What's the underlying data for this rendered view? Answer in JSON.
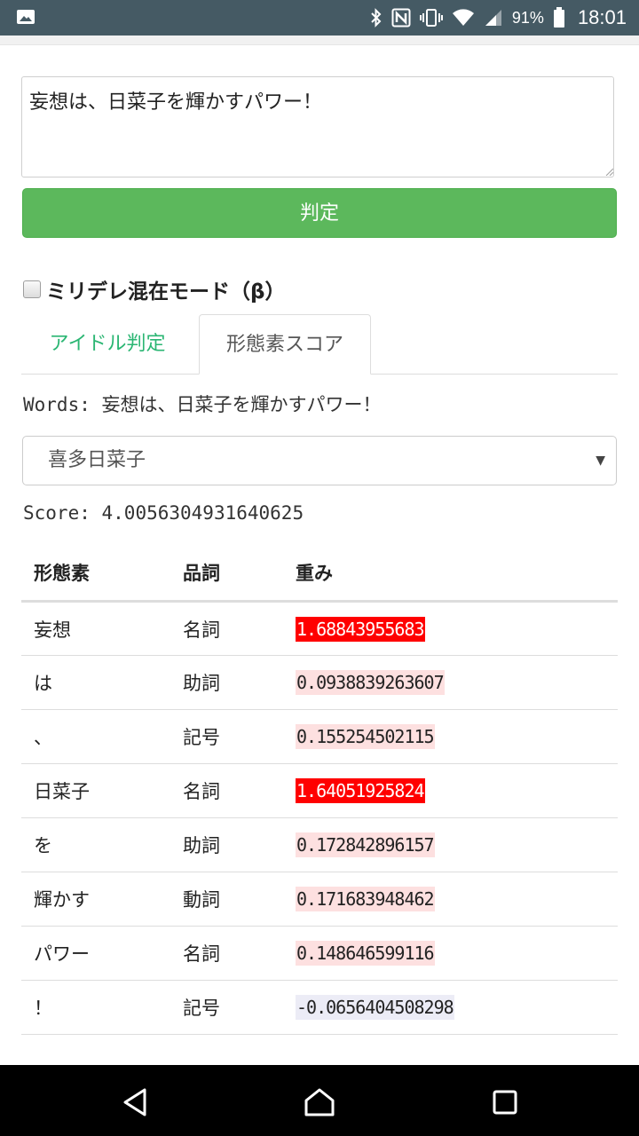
{
  "status_bar": {
    "battery_percent": "91%",
    "time": "18:01"
  },
  "input": {
    "value": "妄想は、日菜子を輝かすパワー！"
  },
  "judge_button": {
    "label": "判定"
  },
  "mode": {
    "label": "ミリデレ混在モード（β）",
    "checked": false
  },
  "tabs": [
    {
      "label": "アイドル判定",
      "active": false
    },
    {
      "label": "形態素スコア",
      "active": true
    }
  ],
  "words": {
    "prefix": "Words: ",
    "text": "妄想は、日菜子を輝かすパワー！"
  },
  "idol_select": {
    "selected": "喜多日菜子"
  },
  "score": {
    "prefix": "Score: ",
    "value": "4.0056304931640625"
  },
  "table": {
    "headers": [
      "形態素",
      "品詞",
      "重み"
    ],
    "rows": [
      {
        "morpheme": "妄想",
        "pos": "名詞",
        "weight": "1.68843955683",
        "level": "high"
      },
      {
        "morpheme": "は",
        "pos": "助詞",
        "weight": "0.0938839263607",
        "level": "low"
      },
      {
        "morpheme": "、",
        "pos": "記号",
        "weight": "0.155254502115",
        "level": "low"
      },
      {
        "morpheme": "日菜子",
        "pos": "名詞",
        "weight": "1.64051925824",
        "level": "high"
      },
      {
        "morpheme": "を",
        "pos": "助詞",
        "weight": "0.172842896157",
        "level": "low"
      },
      {
        "morpheme": "輝かす",
        "pos": "動詞",
        "weight": "0.171683948462",
        "level": "low"
      },
      {
        "morpheme": "パワー",
        "pos": "名詞",
        "weight": "0.148646599116",
        "level": "low"
      },
      {
        "morpheme": "！",
        "pos": "記号",
        "weight": "-0.0656404508298",
        "level": "negative"
      }
    ]
  },
  "colors": {
    "high_bg": "#ff0000",
    "high_fg": "#ffffff",
    "low_bg": "#fde0e0",
    "negative_bg": "#ececf6",
    "accent_green": "#5cb85c",
    "tab_green": "#2bb673"
  },
  "icons": {
    "status_left": "image-notification-icon",
    "status_right": [
      "bluetooth-icon",
      "nfc-icon",
      "vibrate-icon",
      "wifi-icon",
      "signal-icon",
      "battery-icon"
    ],
    "nav": [
      "back-icon",
      "home-icon",
      "recents-icon"
    ]
  }
}
